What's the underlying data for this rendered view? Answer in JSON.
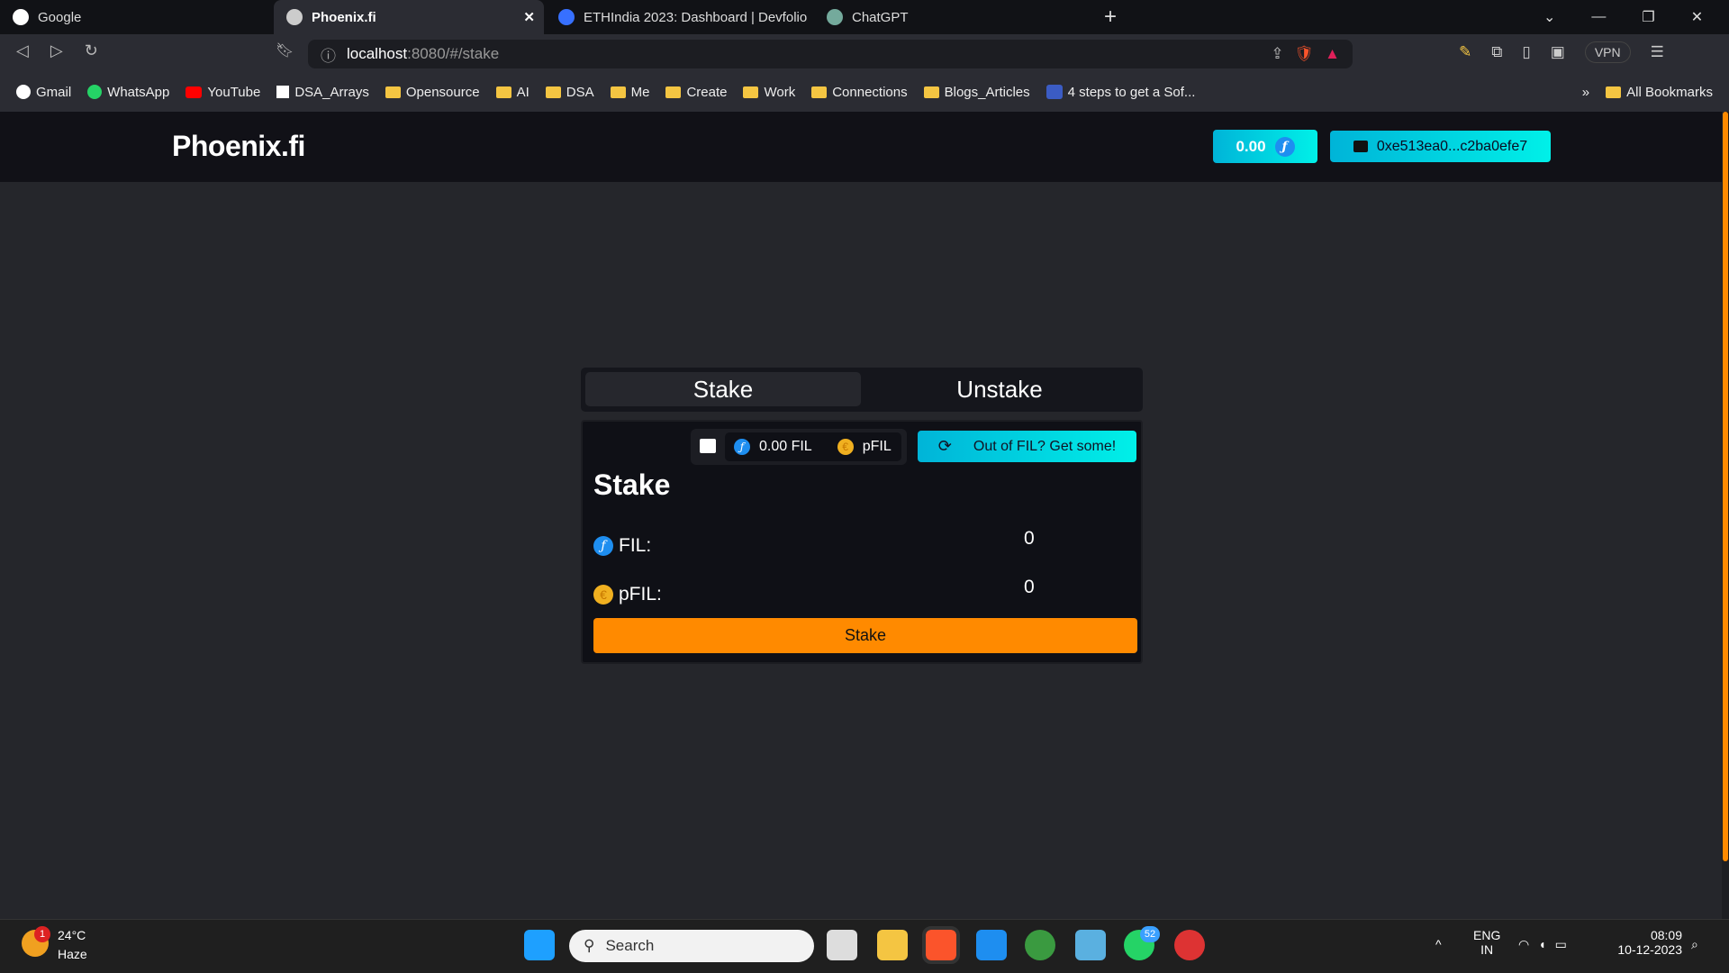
{
  "browser": {
    "tabs": [
      {
        "title": "Google",
        "active": false
      },
      {
        "title": "Phoenix.fi",
        "active": true
      },
      {
        "title": "ETHIndia 2023: Dashboard | Devfolio",
        "active": false
      },
      {
        "title": "ChatGPT",
        "active": false
      }
    ],
    "new_tab": "+",
    "url_host": "localhost",
    "url_rest": ":8080/#/stake",
    "vpn": "VPN",
    "bookmarks": [
      "Gmail",
      "WhatsApp",
      "YouTube",
      "DSA_Arrays",
      "Opensource",
      "AI",
      "DSA",
      "Me",
      "Create",
      "Work",
      "Connections",
      "Blogs_Articles",
      "4 steps to get a Sof..."
    ],
    "more": "»",
    "all_bookmarks": "All Bookmarks"
  },
  "app": {
    "logo": "Phoenix.fi",
    "balance": "0.00",
    "account": "0xe513ea0...c2ba0efe7",
    "tabs": {
      "stake": "Stake",
      "unstake": "Unstake"
    },
    "wallet": {
      "fil_balance": "0.00 FIL",
      "pfil_label": "pFIL"
    },
    "get_fil": "Out of FIL? Get some!",
    "title": "Stake",
    "fil_label": "FIL:",
    "fil_value": "0",
    "pfil_label": "pFIL:",
    "pfil_value": "0",
    "stake_button": "Stake",
    "colors": {
      "accent": "#ff8a00",
      "gradient_start": "#00b4d8",
      "gradient_end": "#00f0e8",
      "fil_blue": "#1e8ef0"
    }
  },
  "taskbar": {
    "weather_temp": "24°C",
    "weather_desc": "Haze",
    "weather_badge": "1",
    "search": "Search",
    "whatsapp_badge": "52",
    "lang": "ENG",
    "region": "IN",
    "time": "08:09",
    "date": "10-12-2023"
  }
}
